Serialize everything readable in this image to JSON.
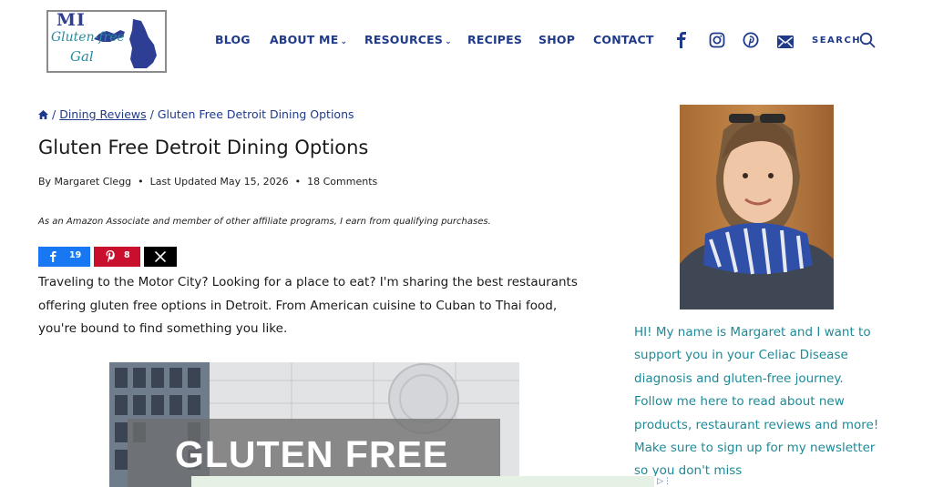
{
  "logo": {
    "line1": "MI",
    "line2": "Gluten-free",
    "line3": "Gal"
  },
  "nav": [
    {
      "label": "BLOG",
      "dropdown": false
    },
    {
      "label": "ABOUT ME",
      "dropdown": true
    },
    {
      "label": "RESOURCES",
      "dropdown": true
    },
    {
      "label": "RECIPES",
      "dropdown": false
    },
    {
      "label": "SHOP",
      "dropdown": false
    },
    {
      "label": "CONTACT",
      "dropdown": false
    }
  ],
  "social_icons": [
    "facebook-icon",
    "instagram-icon",
    "pinterest-icon",
    "email-icon"
  ],
  "search": {
    "label": "SEARCH"
  },
  "breadcrumb": {
    "sep": "/",
    "category": "Dining Reviews",
    "current": "Gluten Free Detroit Dining Options"
  },
  "post": {
    "title": "Gluten Free Detroit Dining Options",
    "meta": {
      "author": "By Margaret Clegg",
      "updated": "Last Updated May 15, 2026",
      "comments": "18 Comments"
    },
    "disclaimer": "As an Amazon Associate and member of other affiliate programs, I earn from qualifying purchases.",
    "intro": "Traveling to the Motor City? Looking for a place to eat? I'm sharing the best restaurants offering gluten free options in Detroit. From American cuisine to Cuban to Thai food, you're bound to find something you like.",
    "hero_text": "GLUTEN FREE"
  },
  "share": {
    "facebook_count": "19",
    "pinterest_count": "8"
  },
  "sidebar": {
    "bio": "HI! My name is Margaret and I want to support you in your Celiac Disease diagnosis and gluten-free journey. Follow me here to read about new products, restaurant reviews and more! Make sure to sign up for my newsletter so you don't miss"
  },
  "colors": {
    "nav": "#1f3a8a",
    "facebook": "#1877f2",
    "pinterest": "#c8102e",
    "x": "#000000",
    "bio_text": "#1e8a97",
    "logo_blue": "#2d3e94"
  }
}
